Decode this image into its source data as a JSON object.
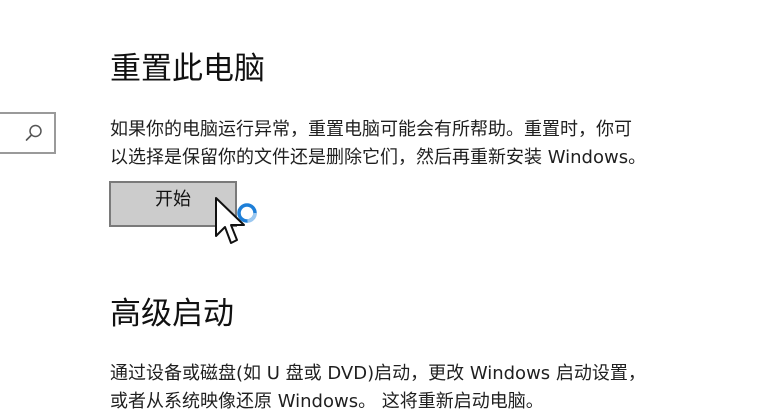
{
  "search": {
    "icon": "search-icon"
  },
  "reset_section": {
    "title": "重置此电脑",
    "description_line1": "如果你的电脑运行异常，重置电脑可能会有所帮助。重置时，你可",
    "description_line2": "以选择是保留你的文件还是删除它们，然后再重新安装 Windows。",
    "start_button_label": "开始"
  },
  "advanced_section": {
    "title": "高级启动",
    "description_line1": "通过设备或磁盘(如 U 盘或 DVD)启动，更改 Windows 启动设置，",
    "description_line2": "或者从系统映像还原 Windows。 这将重新启动电脑。"
  },
  "cursor": {
    "type": "arrow-with-busy-indicator",
    "busy_color": "#1e7fd8"
  }
}
